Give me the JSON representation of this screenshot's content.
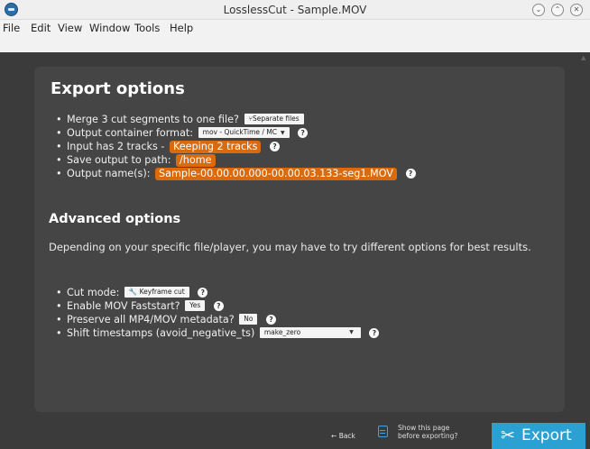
{
  "window": {
    "title": "LosslessCut - Sample.MOV"
  },
  "menu": [
    "File",
    "Edit",
    "View",
    "Window",
    "Tools",
    "Help"
  ],
  "dialog": {
    "title": "Export options",
    "merge_text": "Merge 3 cut segments to one file?",
    "merge_value": "Separate files",
    "container_text": "Output container format:",
    "container_value": "mov - QuickTime / MC",
    "tracks_text": "Input has 2 tracks -",
    "tracks_value": "Keeping 2 tracks",
    "save_text": "Save output to path:",
    "save_value": "/home",
    "name_text": "Output name(s):",
    "name_value": "Sample-00.00.00.000-00.00.03.133-seg1.MOV",
    "advanced_title": "Advanced options",
    "advanced_desc": "Depending on your specific file/player, you may have to try different options for best results.",
    "cut_mode_text": "Cut mode:",
    "cut_mode_value": "Keyframe cut",
    "faststart_text": "Enable MOV Faststart?",
    "faststart_value": "Yes",
    "metadata_text": "Preserve all MP4/MOV metadata?",
    "metadata_value": "No",
    "shift_text": "Shift timestamps (avoid_negative_ts)",
    "shift_value": "make_zero",
    "help_glyph": "?"
  },
  "footer": {
    "back": "Back",
    "show_page_line1": "Show this page",
    "show_page_line2": "before exporting?",
    "export": "Export"
  },
  "icons": {
    "back-arrow-icon": "←",
    "scissors-icon": "✂",
    "wrench-icon": "🔧"
  },
  "colors": {
    "accent_orange": "#d96a0d",
    "export_blue": "#2aa0d3",
    "dialog_bg": "#454545"
  }
}
